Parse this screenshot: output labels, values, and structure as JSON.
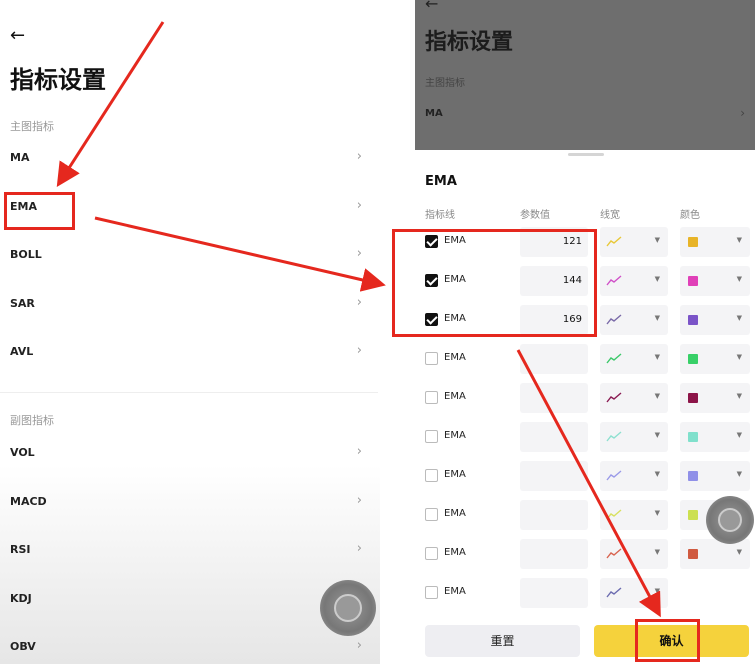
{
  "left": {
    "back": "←",
    "title": "指标设置",
    "main_section": "主图指标",
    "main_items": [
      "MA",
      "EMA",
      "BOLL",
      "SAR",
      "AVL"
    ],
    "sub_section": "副图指标",
    "sub_items": [
      "VOL",
      "MACD",
      "RSI",
      "KDJ",
      "OBV"
    ],
    "chevron": "›"
  },
  "right": {
    "bg_back": "←",
    "bg_title": "指标设置",
    "bg_section": "主图指标",
    "bg_item": "MA",
    "sheet_title": "EMA",
    "headers": {
      "line": "指标线",
      "param": "参数值",
      "width": "线宽",
      "color": "颜色"
    },
    "rows": [
      {
        "label": "EMA",
        "checked": true,
        "value": "121",
        "line_color": "#e8c838",
        "color": "#e8b428"
      },
      {
        "label": "EMA",
        "checked": true,
        "value": "144",
        "line_color": "#d050c8",
        "color": "#e040b8"
      },
      {
        "label": "EMA",
        "checked": true,
        "value": "169",
        "line_color": "#7a6aa8",
        "color": "#7b54c8"
      },
      {
        "label": "EMA",
        "checked": false,
        "value": "",
        "line_color": "#3cc86a",
        "color": "#38d068"
      },
      {
        "label": "EMA",
        "checked": false,
        "value": "",
        "line_color": "#8a1a52",
        "color": "#8c1448"
      },
      {
        "label": "EMA",
        "checked": false,
        "value": "",
        "line_color": "#8ee0d0",
        "color": "#80e0cc"
      },
      {
        "label": "EMA",
        "checked": false,
        "value": "",
        "line_color": "#9a9ae8",
        "color": "#9090e8"
      },
      {
        "label": "EMA",
        "checked": false,
        "value": "",
        "line_color": "#d8e060",
        "color": "#cce050"
      },
      {
        "label": "EMA",
        "checked": false,
        "value": "",
        "line_color": "#d86450",
        "color": "#d05a40"
      },
      {
        "label": "EMA",
        "checked": false,
        "value": "",
        "line_color": "#6c6cb0",
        "color": ""
      }
    ],
    "dropdown_arrow": "▼",
    "reset_label": "重置",
    "confirm_label": "确认"
  },
  "annotation_color": "#e5281e"
}
